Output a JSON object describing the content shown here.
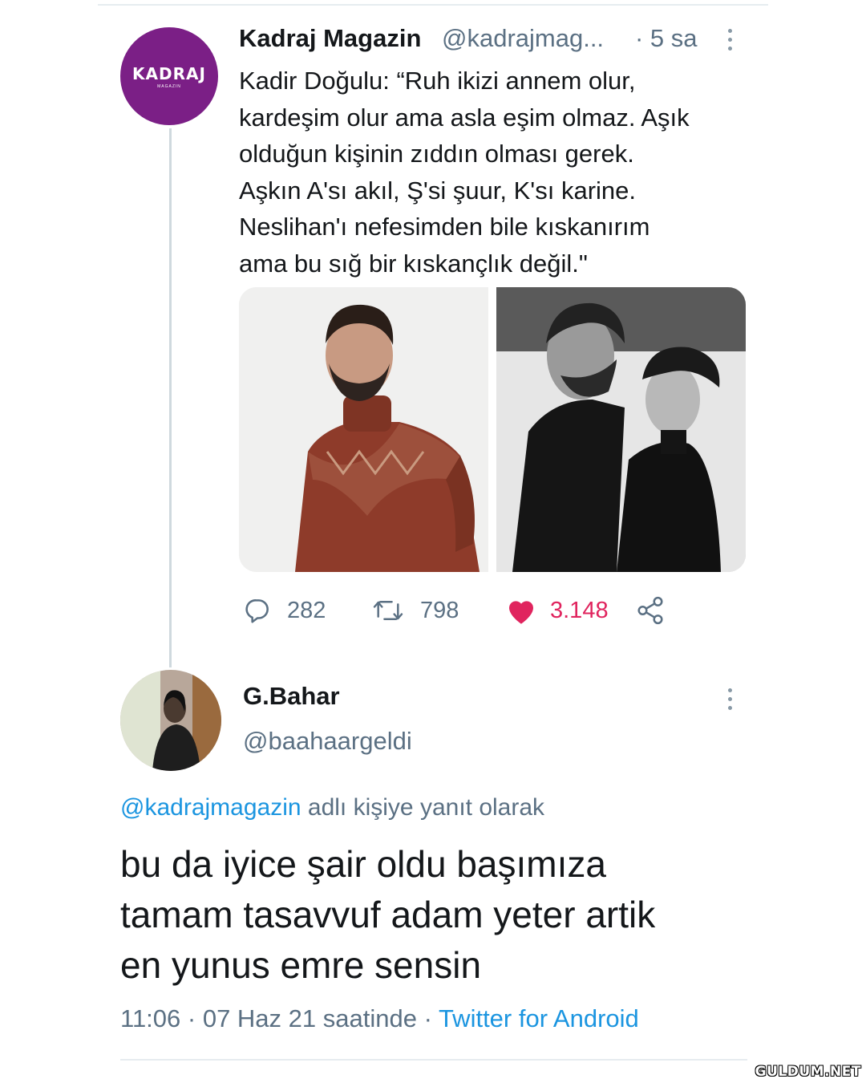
{
  "tweet": {
    "avatar_logo": "KADRAJ",
    "avatar_logo_sub": "MAGAZIN",
    "display_name": "Kadraj Magazin",
    "handle": "@kadrajmag...",
    "time": "· 5 sa",
    "text_lines": [
      "Kadir Doğulu: “Ruh ikizi annem olur,",
      "kardeşim olur ama asla eşim olmaz. Aşık",
      "olduğun kişinin zıddın olması gerek.",
      "Aşkın A'sı akıl, Ş'si şuur, K'sı karine.",
      "Neslihan'ı nefesimden bile kıskanırım",
      "ama bu sığ bir kıskançlık değil.\""
    ],
    "stats": {
      "replies": "282",
      "retweets": "798",
      "likes": "3.148"
    },
    "liked": true
  },
  "reply": {
    "display_name": "G.Bahar",
    "handle": "@baahaargeldi",
    "replying_mention": "@kadrajmagazin",
    "replying_suffix": " adlı kişiye yanıt olarak",
    "text_lines": [
      "bu da iyice şair oldu başımıza",
      "tamam tasavvuf adam yeter artik",
      "en yunus emre sensin"
    ],
    "timestamp": "11:06 · 07 Haz 21 saatinde · ",
    "source_app": "Twitter for Android"
  },
  "watermark": "GULDUM.NET",
  "colors": {
    "link": "#1b95e0",
    "muted": "#5b7083",
    "like": "#e0245e",
    "avatar_bg": "#7b1f86"
  },
  "icons": [
    "reply-icon",
    "retweet-icon",
    "heart-icon",
    "share-icon",
    "more-icon"
  ]
}
